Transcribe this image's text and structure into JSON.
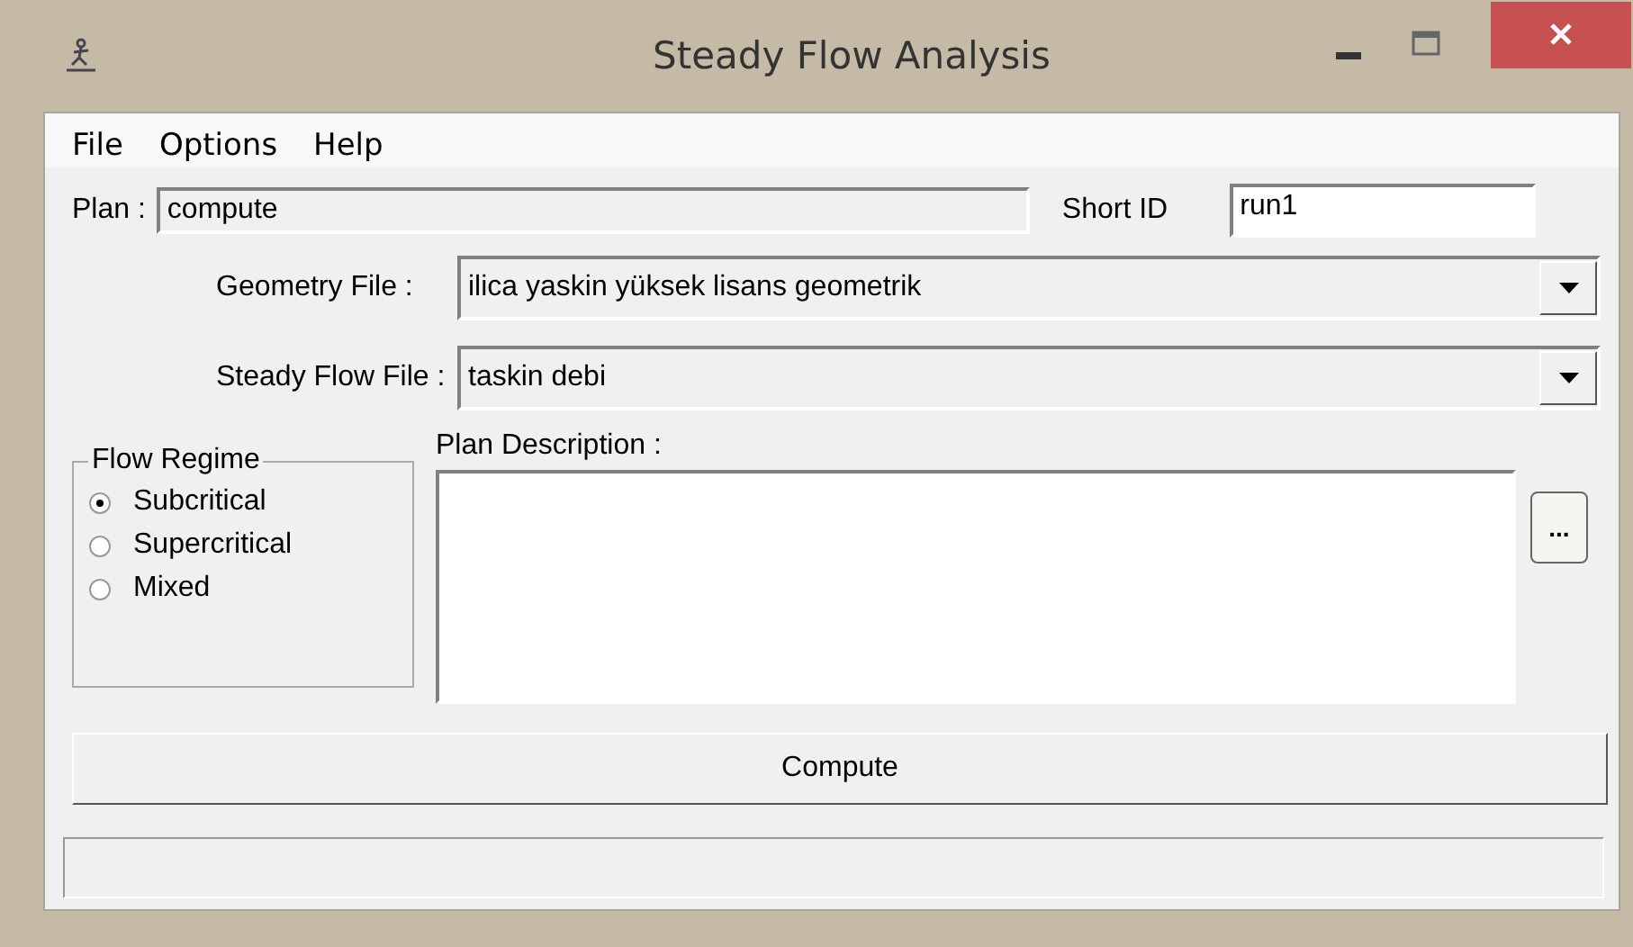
{
  "window": {
    "title": "Steady Flow Analysis"
  },
  "menu": [
    "File",
    "Options",
    "Help"
  ],
  "plan": {
    "label": "Plan :",
    "value": "compute",
    "disabled": true
  },
  "short_id": {
    "label": "Short ID",
    "value": "run1"
  },
  "geometry_file": {
    "label": "Geometry File :",
    "value": "ilica yaskin yüksek lisans geometrik"
  },
  "steady_flow_file": {
    "label": "Steady Flow File :",
    "value": "taskin debi"
  },
  "flow_regime": {
    "title": "Flow Regime",
    "options": [
      {
        "label": "Subcritical",
        "selected": true
      },
      {
        "label": "Supercritical",
        "selected": false
      },
      {
        "label": "Mixed",
        "selected": false
      }
    ]
  },
  "plan_description": {
    "label": "Plan Description :",
    "button": "..."
  },
  "compute_button": "Compute"
}
